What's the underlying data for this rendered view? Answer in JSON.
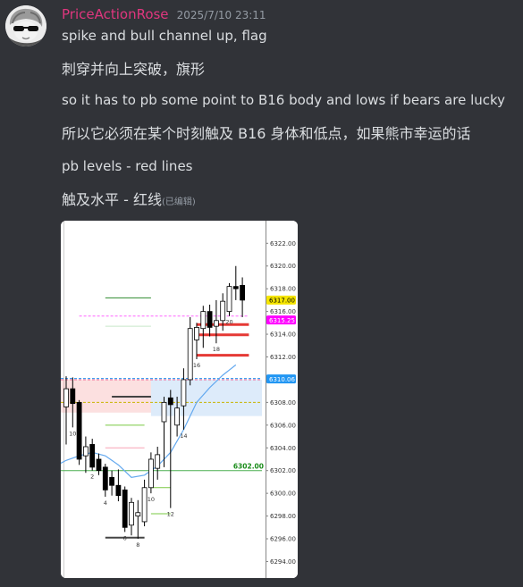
{
  "message": {
    "username": "PriceActionRose",
    "timestamp": "2025/7/10 23:11",
    "lines": [
      {
        "text": "spike and bull channel up, flag",
        "lang": "en"
      },
      {
        "text": "刺穿并向上突破，旗形",
        "lang": "zh"
      },
      {
        "text": "so it has to pb  some point to B16 body and lows if bears are lucky",
        "lang": "en"
      },
      {
        "text": "所以它必须在某个时刻触及 B16 身体和低点，如果熊市幸运的话",
        "lang": "zh"
      },
      {
        "text": "pb levels - red lines",
        "lang": "en"
      },
      {
        "text": "触及水平 - 红线",
        "lang": "zh"
      }
    ],
    "edited_label": "(已编辑)"
  },
  "chart_data": {
    "type": "candlestick",
    "y_ticks": [
      "6322.00",
      "6320.00",
      "6318.00",
      "6316.00",
      "6314.00",
      "6312.00",
      "6310.00",
      "6308.00",
      "6306.00",
      "6304.00",
      "6302.00",
      "6300.00",
      "6298.00",
      "6296.00",
      "6294.00"
    ],
    "price_tags": [
      {
        "value": 6317.0,
        "label": "6317.00",
        "color": "#f5e500",
        "text_color": "#000000"
      },
      {
        "value": 6315.25,
        "label": "6315.25",
        "color": "#ff00ff",
        "text_color": "#ffffff"
      },
      {
        "value": 6310.06,
        "label": "6310.06",
        "color": "#2196f3",
        "text_color": "#ffffff"
      },
      {
        "value": 6302.0,
        "label": "6302.00",
        "color": "#ffffff",
        "text_color": "#1a8c1a"
      }
    ],
    "bar_labels": [
      {
        "text": "10",
        "bar": 1
      },
      {
        "text": "2",
        "bar": 4
      },
      {
        "text": "4",
        "bar": 6
      },
      {
        "text": "6",
        "bar": 9
      },
      {
        "text": "8",
        "bar": 11
      },
      {
        "text": "10",
        "bar": 13
      },
      {
        "text": "12",
        "bar": 16
      },
      {
        "text": "14",
        "bar": 18
      },
      {
        "text": "16",
        "bar": 20
      },
      {
        "text": "18",
        "bar": 23
      },
      {
        "text": "20",
        "bar": 25
      }
    ],
    "candles": [
      {
        "o": 6307.6,
        "h": 6310.3,
        "l": 6304.3,
        "c": 6309.2
      },
      {
        "o": 6309.2,
        "h": 6310.2,
        "l": 6305.8,
        "c": 6307.9
      },
      {
        "o": 6308.0,
        "h": 6308.2,
        "l": 6302.5,
        "c": 6303.0
      },
      {
        "o": 6303.3,
        "h": 6305.0,
        "l": 6301.8,
        "c": 6304.1
      },
      {
        "o": 6304.3,
        "h": 6304.8,
        "l": 6302.0,
        "c": 6302.3
      },
      {
        "o": 6303.0,
        "h": 6303.5,
        "l": 6301.6,
        "c": 6302.0
      },
      {
        "o": 6302.3,
        "h": 6302.6,
        "l": 6299.7,
        "c": 6300.3
      },
      {
        "o": 6301.4,
        "h": 6302.0,
        "l": 6299.8,
        "c": 6300.7
      },
      {
        "o": 6300.7,
        "h": 6302.1,
        "l": 6299.3,
        "c": 6299.8
      },
      {
        "o": 6300.3,
        "h": 6300.6,
        "l": 6296.6,
        "c": 6297.0
      },
      {
        "o": 6297.2,
        "h": 6299.6,
        "l": 6296.3,
        "c": 6299.2
      },
      {
        "o": 6298.0,
        "h": 6299.4,
        "l": 6296.0,
        "c": 6298.3
      },
      {
        "o": 6297.5,
        "h": 6301.2,
        "l": 6297.1,
        "c": 6300.5
      },
      {
        "o": 6300.5,
        "h": 6303.6,
        "l": 6300.0,
        "c": 6303.0
      },
      {
        "o": 6302.2,
        "h": 6304.1,
        "l": 6301.2,
        "c": 6303.4
      },
      {
        "o": 6306.3,
        "h": 6308.5,
        "l": 6302.3,
        "c": 6308.0
      },
      {
        "o": 6308.4,
        "h": 6309.1,
        "l": 6298.7,
        "c": 6307.8
      },
      {
        "o": 6306.0,
        "h": 6308.5,
        "l": 6305.0,
        "c": 6307.5
      },
      {
        "o": 6307.7,
        "h": 6311.0,
        "l": 6305.6,
        "c": 6310.0
      },
      {
        "o": 6310.0,
        "h": 6315.5,
        "l": 6309.5,
        "c": 6314.5
      },
      {
        "o": 6313.5,
        "h": 6315.0,
        "l": 6311.8,
        "c": 6314.6
      },
      {
        "o": 6314.5,
        "h": 6316.5,
        "l": 6312.8,
        "c": 6316.0
      },
      {
        "o": 6316.0,
        "h": 6316.6,
        "l": 6313.8,
        "c": 6314.6
      },
      {
        "o": 6314.7,
        "h": 6317.0,
        "l": 6313.2,
        "c": 6315.2
      },
      {
        "o": 6315.2,
        "h": 6317.6,
        "l": 6314.3,
        "c": 6316.9
      },
      {
        "o": 6316.0,
        "h": 6318.5,
        "l": 6315.6,
        "c": 6318.2
      },
      {
        "o": 6318.2,
        "h": 6320.0,
        "l": 6317.0,
        "c": 6318.0
      },
      {
        "o": 6318.3,
        "h": 6319.0,
        "l": 6315.5,
        "c": 6317.0
      }
    ],
    "hlines": [
      {
        "value": 6314.85,
        "from_bar": 20,
        "to_bar": 28,
        "color": "#e53935",
        "width": 3
      },
      {
        "value": 6313.95,
        "from_bar": 20,
        "to_bar": 28,
        "color": "#e53935",
        "width": 3
      },
      {
        "value": 6312.15,
        "from_bar": 20,
        "to_bar": 28,
        "color": "#e53935",
        "width": 3
      },
      {
        "value": 6317.2,
        "from_bar": 6,
        "to_bar": 13,
        "color": "#2e8b2e",
        "width": 1
      },
      {
        "value": 6308.5,
        "from_bar": 7,
        "to_bar": 13,
        "color": "#444444",
        "width": 2
      },
      {
        "value": 6296.1,
        "from_bar": 6,
        "to_bar": 12,
        "color": "#444444",
        "width": 2
      },
      {
        "value": 6302.0,
        "from_bar": -1,
        "to_bar": 30,
        "color": "#4caf50",
        "width": 1
      },
      {
        "value": 6306.0,
        "from_bar": 6,
        "to_bar": 12,
        "color": "#7ac943",
        "width": 1
      },
      {
        "value": 6298.2,
        "from_bar": 13,
        "to_bar": 16,
        "color": "#7ac943",
        "width": 1
      },
      {
        "value": 6300.5,
        "from_bar": 13,
        "to_bar": 16,
        "color": "#7ac943",
        "width": 1
      },
      {
        "value": 6304.0,
        "from_bar": 6,
        "to_bar": 12,
        "color": "#f9a3b5",
        "width": 1
      },
      {
        "value": 6314.7,
        "from_bar": 6,
        "to_bar": 13,
        "color": "#c8e6c9",
        "width": 1
      }
    ],
    "dashed_lines": [
      {
        "value": 6315.6,
        "from_bar": 2,
        "to_bar": 28,
        "color": "#ff66ff"
      },
      {
        "value": 6310.1,
        "from_bar": -1,
        "to_bar": 30,
        "color": "#2196f3"
      },
      {
        "value": 6310.0,
        "from_bar": -1,
        "to_bar": 30,
        "color": "#f06292"
      },
      {
        "value": 6308.0,
        "from_bar": -1,
        "to_bar": 30,
        "color": "#c8b400"
      }
    ],
    "zones": [
      {
        "from": 6310.0,
        "to": 6307.1,
        "from_bar": -1,
        "to_bar": 13,
        "color": "rgba(244,143,143,0.28)"
      },
      {
        "from": 6310.0,
        "to": 6306.8,
        "from_bar": 13,
        "to_bar": 30,
        "color": "rgba(144,190,240,0.30)"
      }
    ],
    "ma": [
      [
        -1,
        6302.6
      ],
      [
        0,
        6302.9
      ],
      [
        2,
        6303.3
      ],
      [
        4,
        6303.6
      ],
      [
        6,
        6303.3
      ],
      [
        8,
        6302.5
      ],
      [
        10,
        6301.4
      ],
      [
        12,
        6301.6
      ],
      [
        14,
        6302.4
      ],
      [
        16,
        6303.6
      ],
      [
        18,
        6305.6
      ],
      [
        20,
        6308.0
      ],
      [
        22,
        6309.3
      ],
      [
        24,
        6310.4
      ],
      [
        26,
        6311.3
      ]
    ]
  }
}
